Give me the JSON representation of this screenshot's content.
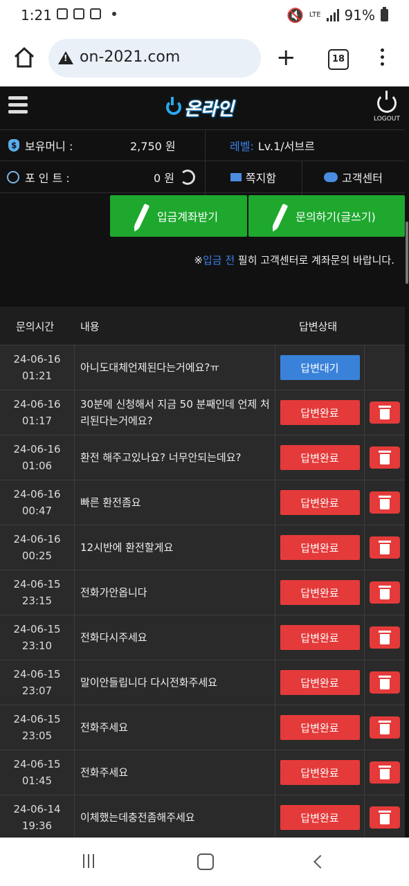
{
  "status_bar": {
    "time": "1:21",
    "lte": "LTE",
    "battery": "91%"
  },
  "browser": {
    "url": "on-2021.com",
    "tab_count": "18"
  },
  "site": {
    "logo": "온라인",
    "logout": "LOGOUT",
    "money_label": "보유머니 :",
    "money_value": "2,750 원",
    "level_label": "레벨:",
    "level_value": "Lv.1/서브르",
    "point_label": "포 인 트 :",
    "point_value": "0 원",
    "message_label": "쪽지함",
    "support_label": "고객센터",
    "deposit_button": "입금계좌받기",
    "inquiry_button": "문의하기(글쓰기)",
    "notice_prefix": "※",
    "notice_highlight": "입금 전",
    "notice_rest": " 필히 고객센터로 계좌문의 바랍니다."
  },
  "table": {
    "headers": {
      "time": "문의시간",
      "content": "내용",
      "status": "답변상태"
    },
    "rows": [
      {
        "date": "24-06-16",
        "time": "01:21",
        "content": "아니도대체언제된다는거에요?ㅠ",
        "status": "답변대기",
        "pending": true
      },
      {
        "date": "24-06-16",
        "time": "01:17",
        "content": "30분에 신청해서 지금 50 분째인데 언제 처리된다는거에요?",
        "status": "답변완료",
        "pending": false
      },
      {
        "date": "24-06-16",
        "time": "01:06",
        "content": "환전 해주고있나요? 너무안되는데요?",
        "status": "답변완료",
        "pending": false
      },
      {
        "date": "24-06-16",
        "time": "00:47",
        "content": "빠른 환전좀요",
        "status": "답변완료",
        "pending": false
      },
      {
        "date": "24-06-16",
        "time": "00:25",
        "content": "12시반에 환전할게요",
        "status": "답변완료",
        "pending": false
      },
      {
        "date": "24-06-15",
        "time": "23:15",
        "content": "전화가안옵니다",
        "status": "답변완료",
        "pending": false
      },
      {
        "date": "24-06-15",
        "time": "23:10",
        "content": "전화다시주세요",
        "status": "답변완료",
        "pending": false
      },
      {
        "date": "24-06-15",
        "time": "23:07",
        "content": "말이안들립니다 다시전화주세요",
        "status": "답변완료",
        "pending": false
      },
      {
        "date": "24-06-15",
        "time": "23:05",
        "content": "전화주세요",
        "status": "답변완료",
        "pending": false
      },
      {
        "date": "24-06-15",
        "time": "01:45",
        "content": "전화주세요",
        "status": "답변완료",
        "pending": false
      },
      {
        "date": "24-06-14",
        "time": "19:36",
        "content": "이체했는데충전좀해주세요",
        "status": "답변완료",
        "pending": false
      }
    ]
  },
  "colors": {
    "pending": "#3a82d9",
    "done": "#e53a3a",
    "green": "#1ea82e"
  }
}
